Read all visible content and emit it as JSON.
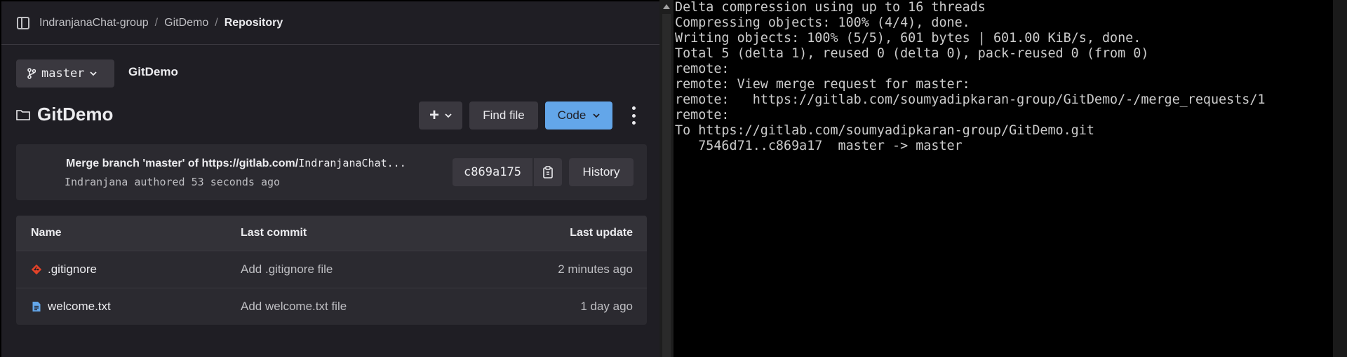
{
  "breadcrumb": {
    "group": "IndranjanaChat-group",
    "project": "GitDemo",
    "current": "Repository"
  },
  "branch_selector": {
    "label": "master"
  },
  "project_link": "GitDemo",
  "project_title": "GitDemo",
  "toolbar": {
    "add_label": "+",
    "find_file_label": "Find file",
    "code_label": "Code"
  },
  "last_commit": {
    "message_bold": "Merge branch 'master' of https://gitlab.com/",
    "message_mono": "IndranjanaChat...",
    "meta": "Indranjana authored 53 seconds ago",
    "sha": "c869a175",
    "history_label": "History"
  },
  "file_table": {
    "headers": {
      "name": "Name",
      "last_commit": "Last commit",
      "last_update": "Last update"
    },
    "rows": [
      {
        "name": ".gitignore",
        "icon": "git-file-icon",
        "last_commit": "Add .gitignore file",
        "last_update": "2 minutes ago"
      },
      {
        "name": "welcome.txt",
        "icon": "text-file-icon",
        "last_commit": "Add welcome.txt file",
        "last_update": "1 day ago"
      }
    ]
  },
  "terminal": {
    "lines": [
      "Delta compression using up to 16 threads",
      "Compressing objects: 100% (4/4), done.",
      "Writing objects: 100% (5/5), 601 bytes | 601.00 KiB/s, done.",
      "Total 5 (delta 1), reused 0 (delta 0), pack-reused 0 (from 0)",
      "remote:",
      "remote: View merge request for master:",
      "remote:   https://gitlab.com/soumyadipkaran-group/GitDemo/-/merge_requests/1",
      "remote:",
      "To https://gitlab.com/soumyadipkaran-group/GitDemo.git",
      "   7546d71..c869a17  master -> master"
    ]
  },
  "colors": {
    "panel_bg": "#1f1e24",
    "card_bg": "#2b2a30",
    "button_bg": "#3a383f",
    "code_button": "#63a6e9",
    "git_icon": "#e24329",
    "txt_icon": "#63a6e9",
    "terminal_text": "#cccccc"
  }
}
